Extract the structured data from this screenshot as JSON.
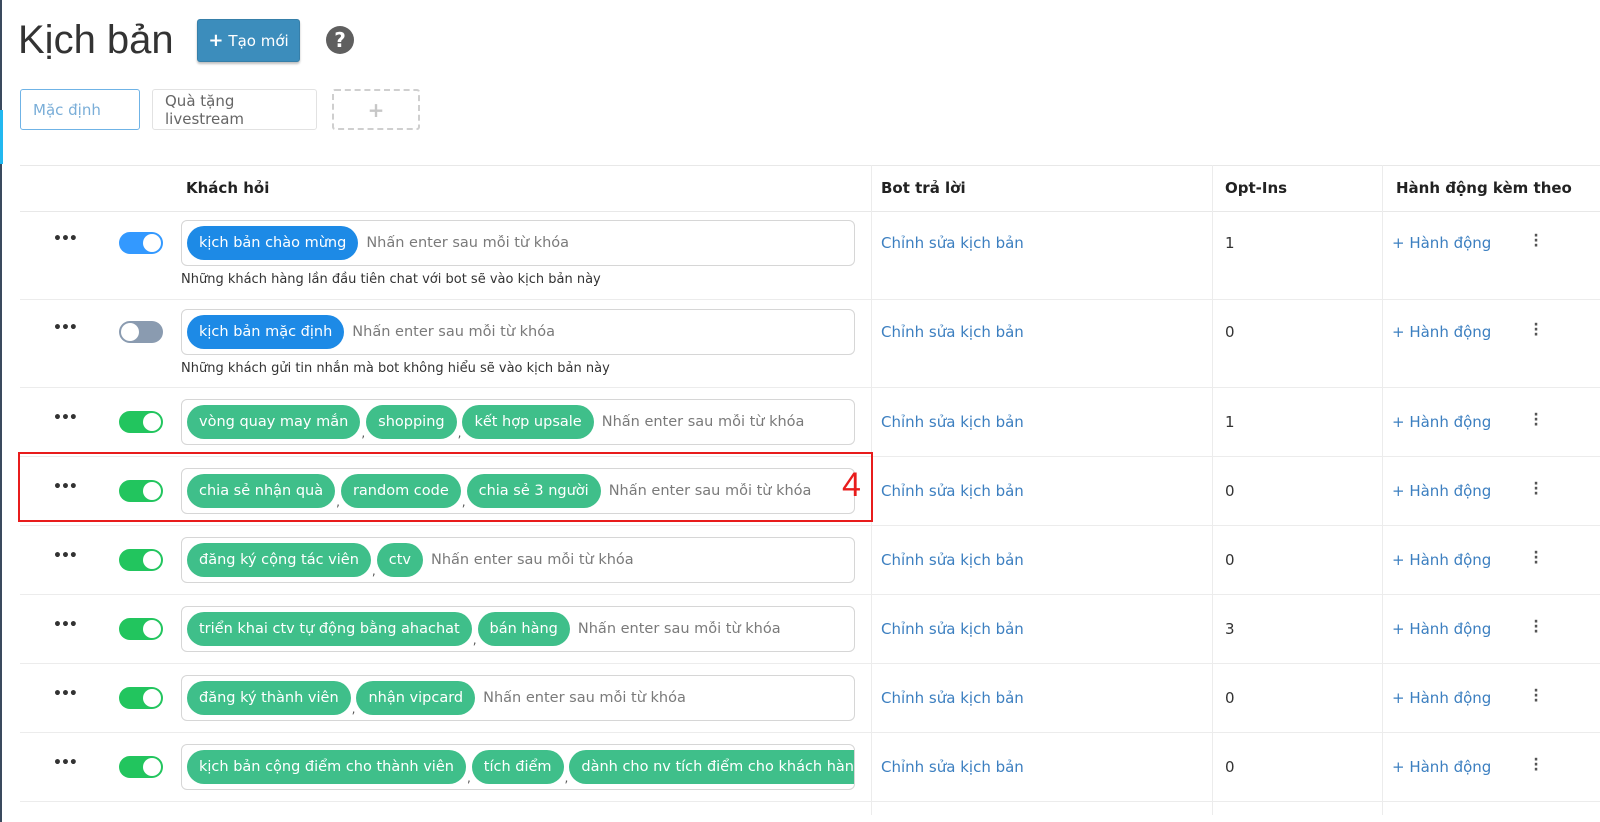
{
  "header": {
    "title": "Kịch bản",
    "create_label": "Tạo mới",
    "help": "?"
  },
  "tabs": [
    {
      "label": "Mặc định",
      "active": true
    },
    {
      "label": "Quà tặng livestream",
      "active": false
    },
    {
      "label": "+",
      "active": false
    }
  ],
  "table": {
    "columns": [
      "Khách hỏi",
      "Bot trả lời",
      "Opt-Ins",
      "Hành động kèm theo"
    ],
    "rows": [
      {
        "enabled": true,
        "toggle_color": "#3399ff",
        "tags": [
          "kịch bản chào mừng"
        ],
        "tag_color": "blue",
        "description": "Những khách hàng lần đầu tiên chat với bot sẽ vào kịch bản này",
        "bot_reply": "Chỉnh sửa kịch bản",
        "optins": "1",
        "action": "+ Hành động"
      },
      {
        "enabled": false,
        "toggle_color": "#8a9bb0",
        "tags": [
          "kịch bản mặc định"
        ],
        "tag_color": "blue",
        "description": "Những khách gửi tin nhắn mà bot không hiểu sẽ vào kịch bản này",
        "bot_reply": "Chỉnh sửa kịch bản",
        "optins": "0",
        "action": "+ Hành động"
      },
      {
        "enabled": true,
        "toggle_color": "#22c55e",
        "tags": [
          "vòng quay may mắn",
          "shopping",
          "kết hợp upsale"
        ],
        "tag_color": "green",
        "bot_reply": "Chỉnh sửa kịch bản",
        "optins": "1",
        "action": "+ Hành động"
      },
      {
        "enabled": true,
        "toggle_color": "#22c55e",
        "tags": [
          "chia sẻ nhận quà",
          "random code",
          "chia sẻ 3 người"
        ],
        "tag_color": "green",
        "bot_reply": "Chỉnh sửa kịch bản",
        "optins": "0",
        "action": "+ Hành động"
      },
      {
        "enabled": true,
        "toggle_color": "#22c55e",
        "tags": [
          "đăng ký cộng tác viên",
          "ctv"
        ],
        "tag_color": "green",
        "bot_reply": "Chỉnh sửa kịch bản",
        "optins": "0",
        "action": "+ Hành động"
      },
      {
        "enabled": true,
        "toggle_color": "#22c55e",
        "tags": [
          "triển khai ctv tự động bằng ahachat",
          "bán hàng"
        ],
        "tag_color": "green",
        "bot_reply": "Chỉnh sửa kịch bản",
        "optins": "3",
        "action": "+ Hành động"
      },
      {
        "enabled": true,
        "toggle_color": "#22c55e",
        "tags": [
          "đăng ký thành viên",
          "nhận vipcard"
        ],
        "tag_color": "green",
        "bot_reply": "Chỉnh sửa kịch bản",
        "optins": "0",
        "action": "+ Hành động"
      },
      {
        "enabled": true,
        "toggle_color": "#22c55e",
        "tags": [
          "kịch bản cộng điểm cho thành viên",
          "tích điểm",
          "dành cho nv tích điểm cho khách hàng"
        ],
        "tag_color": "green",
        "bot_reply": "Chỉnh sửa kịch bản",
        "optins": "0",
        "action": "+ Hành động"
      }
    ],
    "keyword_placeholder": "Nhấn enter sau mỗi từ khóa"
  },
  "annotation": {
    "label": "4"
  }
}
